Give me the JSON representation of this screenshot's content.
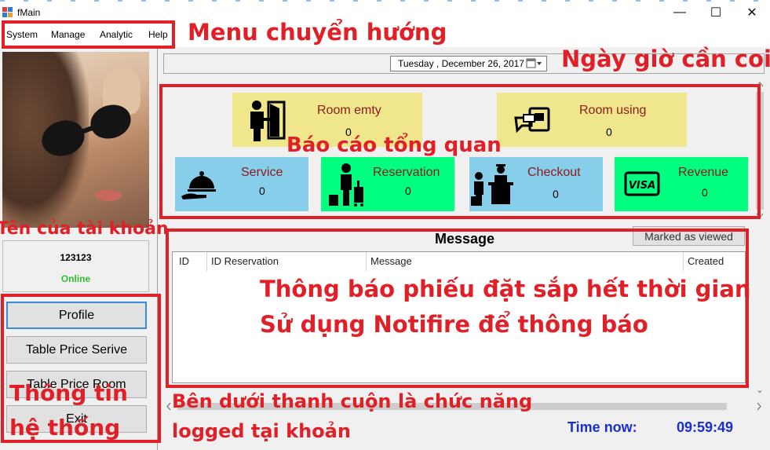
{
  "window": {
    "title": "fMain",
    "minimize": "—",
    "maximize": "☐",
    "close": "✕"
  },
  "menu": {
    "items": [
      "System",
      "Manage",
      "Analytic",
      "Help"
    ]
  },
  "date_picker": {
    "value": "Tuesday   , December 26, 2017"
  },
  "tiles": [
    {
      "label": "Room emty",
      "value": "0",
      "color": "#f0e68c",
      "icon": "room-door-icon"
    },
    {
      "label": "Room using",
      "value": "0",
      "color": "#f0e68c",
      "icon": "card-reader-icon"
    },
    {
      "label": "Service",
      "value": "0",
      "color": "#87ceeb",
      "icon": "service-bell-icon"
    },
    {
      "label": "Reservation",
      "value": "0",
      "color": "#00ff7f",
      "icon": "traveler-luggage-icon"
    },
    {
      "label": "Checkout",
      "value": "0",
      "color": "#87ceeb",
      "icon": "checkout-desk-icon"
    },
    {
      "label": "Revenue",
      "value": "0",
      "color": "#00ff7f",
      "icon": "visa-card-icon"
    }
  ],
  "account": {
    "name": "123123",
    "status": "Online",
    "status_color": "#2ebd2e"
  },
  "sidebar_buttons": [
    "Profile",
    "Table Price Serive",
    "Table Price Room",
    "Exit"
  ],
  "message": {
    "title": "Message",
    "mark_button": "Marked as viewed",
    "columns": [
      "ID",
      "ID Reservation",
      "Message",
      "Created"
    ]
  },
  "time": {
    "label": "Time now:",
    "value": "09:59:49"
  },
  "annotations": {
    "menu": "Menu chuyển hướng",
    "date": "Ngày giờ cần coi",
    "summary": "Báo cáo tổng quan",
    "account": "Tên của tài khoản",
    "msg_line1": "Thông báo phiếu đặt sắp hết thời gian",
    "msg_line2": "Sử dụng Notifire để thông báo",
    "sys_line1": "Thông tin",
    "sys_line2": "hệ thống",
    "scroll_line1": "Bên dưới thanh cuộn là chức năng",
    "scroll_line2": "logged tại khoản"
  },
  "colors": {
    "annotation": "#e01f26",
    "time": "#1a2ed0",
    "tile_label": "#8b1a1a"
  }
}
